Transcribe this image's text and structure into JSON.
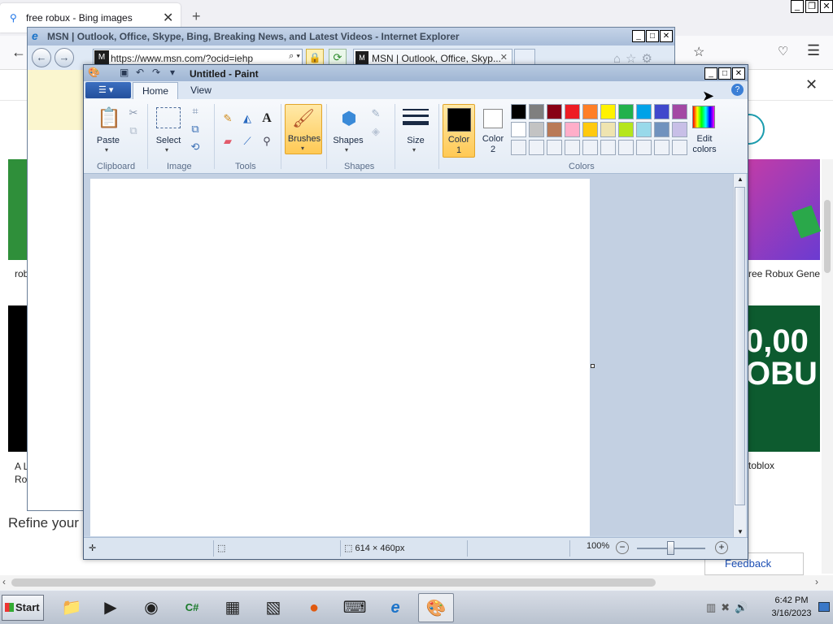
{
  "firefox": {
    "tab_title": "free robux - Bing images",
    "new_tab": "+",
    "tab_close": "✕"
  },
  "bing": {
    "card_label_left_1": "rob",
    "card_label_right_1": "ree Robux Gene",
    "card_label_left_2_line1": "A L",
    "card_label_left_2_line2": "Ro",
    "card_label_right_2": "toblox",
    "card_right_2_text_line1": "0,00",
    "card_right_2_text_line2": "OBU",
    "refine": "Refine your",
    "feedback": "Feedback"
  },
  "ie": {
    "title": "MSN | Outlook, Office, Skype, Bing, Breaking News, and Latest Videos - Internet Explorer",
    "url": "https://www.msn.com/?ocid=iehp",
    "tab_title": "MSN | Outlook, Office, Skyp...",
    "tab_close": "✕"
  },
  "paint": {
    "title": "Untitled - Paint",
    "tabs": {
      "home": "Home",
      "view": "View"
    },
    "ribbon": {
      "paste": "Paste",
      "select": "Select",
      "brushes": "Brushes",
      "shapes": "Shapes",
      "size": "Size",
      "color1_l1": "Color",
      "color1_l2": "1",
      "color2_l1": "Color",
      "color2_l2": "2",
      "edit_colors_l1": "Edit",
      "edit_colors_l2": "colors"
    },
    "groups": {
      "clipboard": "Clipboard",
      "image": "Image",
      "tools": "Tools",
      "shapes": "Shapes",
      "colors": "Colors"
    },
    "palette_row1": [
      "#000000",
      "#7f7f7f",
      "#880015",
      "#ed1c24",
      "#ff7f27",
      "#fff200",
      "#22b14c",
      "#00a2e8",
      "#3f48cc",
      "#a349a4"
    ],
    "palette_row2": [
      "#ffffff",
      "#c3c3c3",
      "#b97a57",
      "#ffaec9",
      "#ffc90e",
      "#efe4b0",
      "#b5e61d",
      "#99d9ea",
      "#7092be",
      "#c8bfe7"
    ],
    "palette_row3": [
      "#eef2f8",
      "#eef2f8",
      "#eef2f8",
      "#eef2f8",
      "#eef2f8",
      "#eef2f8",
      "#eef2f8",
      "#eef2f8",
      "#eef2f8",
      "#eef2f8"
    ],
    "status": {
      "canvas_size": "614 × 460px",
      "zoom": "100%"
    }
  },
  "taskbar": {
    "start": "Start",
    "time": "6:42 PM",
    "date": "3/16/2023"
  }
}
